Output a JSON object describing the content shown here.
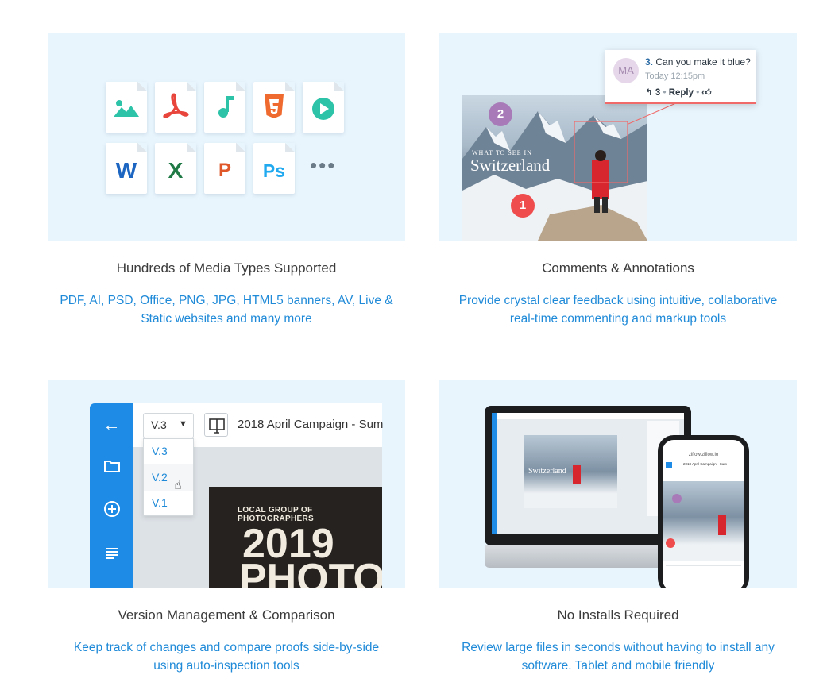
{
  "cards": [
    {
      "title": "Hundreds of Media Types Supported",
      "desc_line1": "PDF, AI, PSD, Office, PNG, JPG, HTML5 banners, AV, Live &",
      "desc_line2": "Static websites and many more"
    },
    {
      "title": "Comments & Annotations",
      "desc_line1": "Provide crystal clear feedback using intuitive, collaborative",
      "desc_line2": "real-time commenting and markup tools"
    },
    {
      "title": "Version Management & Comparison",
      "desc_line1": "Keep track of changes and compare proofs side-by-side",
      "desc_line2": "using auto-inspection tools"
    },
    {
      "title": "No Installs Required",
      "desc_line1": "Review large files in seconds without having to install any",
      "desc_line2": "software. Tablet and mobile friendly"
    }
  ],
  "media_icons": {
    "row1": [
      "image-icon",
      "pdf-icon",
      "audio-icon",
      "html5-icon",
      "video-icon"
    ],
    "word_glyph": "W",
    "excel_glyph": "X",
    "powerpoint_glyph": "P",
    "photoshop_glyph": "Ps",
    "more": "•••",
    "colors": {
      "image": "#2cc3a8",
      "pdf": "#e8453c",
      "audio": "#2cc3a8",
      "html5": "#ef6a2e",
      "video": "#2cc3a8",
      "word": "#1c66c2",
      "excel": "#1f7a45",
      "powerpoint": "#e0572a",
      "photoshop": "#21a9ef"
    }
  },
  "comment": {
    "avatar_initials": "MA",
    "number": "3.",
    "text": "Can you make it blue?",
    "time": "Today 12:15pm",
    "reply_count": "3",
    "reply_label": "Reply",
    "pin_2": "2",
    "pin_1": "1",
    "photo_kicker": "WHAT TO SEE IN",
    "photo_title": "Switzerland",
    "accent": "#f06a6a",
    "pin_purple": "#a87ab8"
  },
  "versions": {
    "selected": "V.3",
    "options": [
      "V.3",
      "V.2",
      "V.1"
    ],
    "campaign": "2018 April Campaign - Sum",
    "poster_kicker": "LOCAL GROUP OF PHOTOGRAPHERS",
    "poster_year": "2019",
    "poster_word": "PHOTO",
    "sidebar_color": "#1e8ce6"
  },
  "devices": {
    "phone_url": "ziflow.ziflow.io",
    "phone_title": "2018 April Campaign - Sum",
    "screen_title": "Switzerland"
  }
}
